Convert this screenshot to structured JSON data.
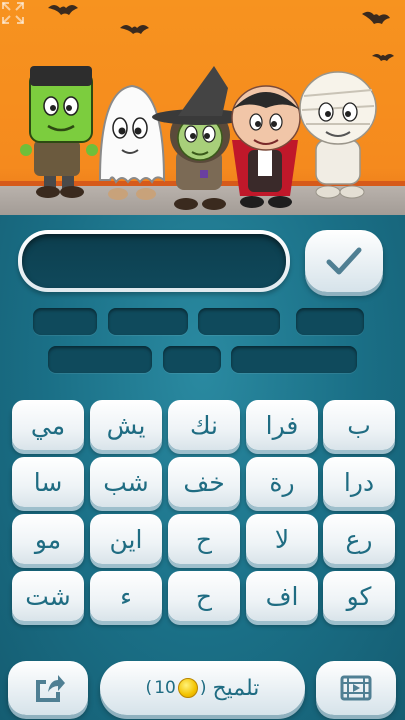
{
  "answer": {
    "current_text": "",
    "submit_icon": "checkmark-icon"
  },
  "answer_slots": {
    "row1_lengths": [
      4,
      4,
      4,
      3
    ],
    "row2_lengths": [
      4,
      2,
      5
    ]
  },
  "letter_grid": [
    [
      "مي",
      "يش",
      "نك",
      "فرا",
      "ب"
    ],
    [
      "سا",
      "شب",
      "خف",
      "رة",
      "درا"
    ],
    [
      "مو",
      "اين",
      "ح",
      "لا",
      "رع"
    ],
    [
      "شت",
      "ء",
      "ح",
      "اف",
      "كو"
    ]
  ],
  "bottom_bar": {
    "share_icon": "share-icon",
    "hint_label": "تلميح",
    "hint_cost": "10",
    "hint_cost_icon": "coin-icon",
    "video_icon": "video-film-icon"
  },
  "scene": {
    "description_icons": [
      "frankenstein-icon",
      "ghost-icon",
      "witch-icon",
      "vampire-icon",
      "mummy-icon",
      "bat-icon"
    ],
    "expand_icon": "expand-icon"
  },
  "colors": {
    "sky": "#f7931f",
    "panel": "#1a6f86",
    "key_text": "#1f6c82"
  }
}
